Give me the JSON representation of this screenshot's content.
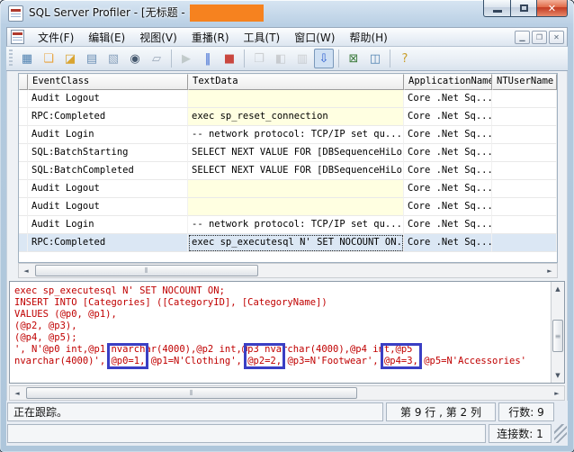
{
  "window": {
    "title": "SQL Server Profiler - [无标题 - 1",
    "redaction_color": "#f6821f"
  },
  "menu": {
    "items": [
      {
        "id": "file",
        "label": "文件(F)"
      },
      {
        "id": "edit",
        "label": "编辑(E)"
      },
      {
        "id": "view",
        "label": "视图(V)"
      },
      {
        "id": "replay",
        "label": "重播(R)"
      },
      {
        "id": "tools",
        "label": "工具(T)"
      },
      {
        "id": "window",
        "label": "窗口(W)"
      },
      {
        "id": "help",
        "label": "帮助(H)"
      }
    ]
  },
  "toolbar": {
    "items": [
      {
        "name": "trace-properties-icon",
        "glyph": "▦",
        "color": "#4f81b0"
      },
      {
        "name": "new-trace-icon",
        "glyph": "❏",
        "color": "#e8a33d"
      },
      {
        "name": "open-trace-icon",
        "glyph": "◪",
        "color": "#d9a430"
      },
      {
        "name": "save-trace-icon",
        "glyph": "▤",
        "color": "#6a8fb5"
      },
      {
        "name": "properties-icon",
        "glyph": "▧",
        "color": "#8aa2bd"
      },
      {
        "name": "find-icon",
        "glyph": "◉",
        "color": "#45586e"
      },
      {
        "name": "eraser-icon",
        "glyph": "▱",
        "color": "#9aa7b8"
      },
      {
        "sep": true
      },
      {
        "name": "start-trace-icon",
        "glyph": "▶",
        "color": "#6f9f7f",
        "disabled": true
      },
      {
        "name": "pause-trace-icon",
        "glyph": "‖",
        "color": "#2e5fd0"
      },
      {
        "name": "stop-trace-icon",
        "glyph": "■",
        "color": "#c9473f"
      },
      {
        "sep": true
      },
      {
        "name": "organize-columns-icon",
        "glyph": "❐",
        "color": "#9b9b9b",
        "disabled": true
      },
      {
        "name": "grouped-view-icon",
        "glyph": "◧",
        "color": "#9b9b9b",
        "disabled": true
      },
      {
        "name": "aggregate-view-icon",
        "glyph": "▥",
        "color": "#9b9b9b",
        "disabled": true
      },
      {
        "name": "auto-scroll-icon",
        "glyph": "⇩",
        "color": "#2e5fd0",
        "active": true
      },
      {
        "sep": true
      },
      {
        "name": "export-icon",
        "glyph": "⊠",
        "color": "#3f7d3f"
      },
      {
        "name": "performance-counters-icon",
        "glyph": "◫",
        "color": "#4f81b0"
      },
      {
        "sep": true
      },
      {
        "name": "help-icon",
        "glyph": "?",
        "color": "#c99e2a"
      }
    ]
  },
  "grid": {
    "columns": [
      "EventClass",
      "TextData",
      "ApplicationName",
      "NTUserName"
    ],
    "rows": [
      {
        "event": "Audit Logout",
        "text": "",
        "app": "Core .Net Sq...",
        "ntuser": "",
        "text_highlight": true,
        "selected": false
      },
      {
        "event": "RPC:Completed",
        "text": "exec sp_reset_connection",
        "app": "Core .Net Sq...",
        "ntuser": "",
        "text_highlight": true,
        "selected": false
      },
      {
        "event": "Audit Login",
        "text": "-- network protocol: TCP/IP  set qu...",
        "app": "Core .Net Sq...",
        "ntuser": "",
        "text_highlight": false,
        "selected": false
      },
      {
        "event": "SQL:BatchStarting",
        "text": "SELECT NEXT VALUE FOR [DBSequenceHiLo]",
        "app": "Core .Net Sq...",
        "ntuser": "",
        "text_highlight": false,
        "selected": false
      },
      {
        "event": "SQL:BatchCompleted",
        "text": "SELECT NEXT VALUE FOR [DBSequenceHiLo]",
        "app": "Core .Net Sq...",
        "ntuser": "",
        "text_highlight": false,
        "selected": false
      },
      {
        "event": "Audit Logout",
        "text": "",
        "app": "Core .Net Sq...",
        "ntuser": "",
        "text_highlight": true,
        "selected": false
      },
      {
        "event": "Audit Logout",
        "text": "",
        "app": "Core .Net Sq...",
        "ntuser": "",
        "text_highlight": true,
        "selected": false
      },
      {
        "event": "Audit Login",
        "text": "-- network protocol: TCP/IP  set qu...",
        "app": "Core .Net Sq...",
        "ntuser": "",
        "text_highlight": false,
        "selected": false
      },
      {
        "event": "RPC:Completed",
        "text": "exec sp_executesql N' SET NOCOUNT ON...",
        "app": "Core .Net Sq...",
        "ntuser": "",
        "text_highlight": false,
        "selected": true
      }
    ]
  },
  "detail": {
    "text_color": "#c00000",
    "annotation_color": "#3a3fc4",
    "highlighted_params": [
      "@p0=1",
      "@p2=2",
      "@p4=3"
    ],
    "lines": [
      {
        "segs": [
          {
            "t": "exec sp_executesql N' SET NOCOUNT ON;"
          }
        ]
      },
      {
        "segs": [
          {
            "t": "INSERT INTO [Categories] ([CategoryID], [CategoryName])"
          }
        ]
      },
      {
        "segs": [
          {
            "t": "VALUES (@p0, @p1),"
          }
        ]
      },
      {
        "segs": [
          {
            "t": "(@p2, @p3),"
          }
        ]
      },
      {
        "segs": [
          {
            "t": "(@p4, @p5);"
          }
        ]
      },
      {
        "segs": [
          {
            "t": "', N'@p0 int,@p1 nvarchar(4000),@p2 int,@p3 nvarchar(4000),@p4 int,@p5"
          }
        ]
      },
      {
        "segs": [
          {
            "t": "nvarchar(4000)', "
          },
          {
            "t": "@p0=1,",
            "box": true
          },
          {
            "t": " @p1=N'Clothing', "
          },
          {
            "t": "@p2=2,",
            "box": true
          },
          {
            "t": " @p3=N'Footwear', "
          },
          {
            "t": "@p4=3,",
            "box": true
          },
          {
            "t": " @p5=N'Accessories'"
          }
        ]
      }
    ]
  },
  "status": {
    "state": "正在跟踪。",
    "position": "第 9 行 , 第 2 列",
    "row_count": "行数: 9",
    "connections": "连接数: 1"
  }
}
